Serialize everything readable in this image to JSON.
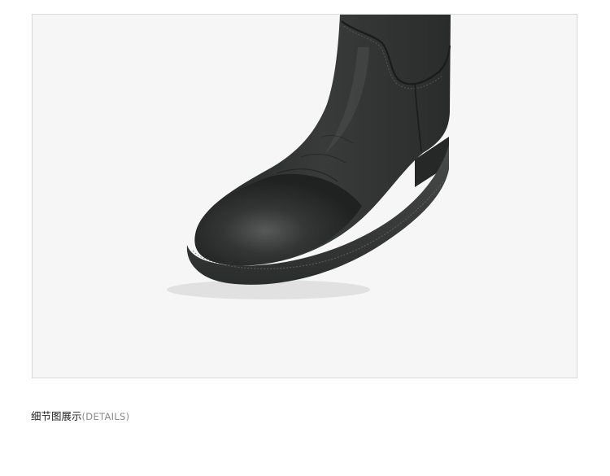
{
  "caption": {
    "title": "细节图展示",
    "subtitle": "(DETAILS)"
  },
  "colors": {
    "background": "#ffffff",
    "photo_background": "#f6f6f6",
    "frame_border": "#d9d9d9",
    "leather": "#2b2d2c",
    "sole": "#3a3b3b",
    "caption_text": "#222222",
    "caption_subtext": "#8a8a8a"
  }
}
